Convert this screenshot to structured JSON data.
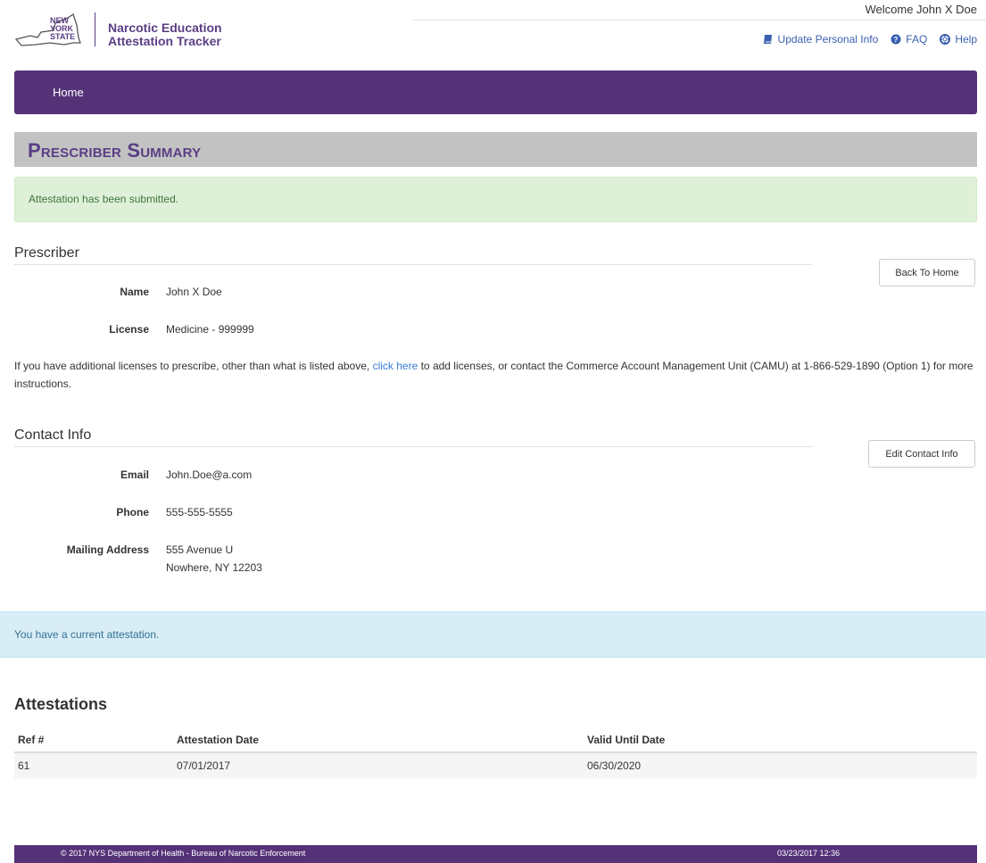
{
  "header": {
    "brand_lines": [
      "NEW",
      "YORK",
      "STATE"
    ],
    "app_title_line1": "Narcotic Education",
    "app_title_line2": "Attestation Tracker",
    "welcome": "Welcome John X Doe",
    "links": {
      "update_info": "Update Personal Info",
      "faq": "FAQ",
      "help": "Help"
    }
  },
  "nav": {
    "home": "Home"
  },
  "page_title": "Prescriber Summary",
  "success_alert": "Attestation has been submitted.",
  "prescriber": {
    "heading": "Prescriber",
    "back_button": "Back To Home",
    "name_label": "Name",
    "name_value": "John X Doe",
    "license_label": "License",
    "license_value": "Medicine - 999999"
  },
  "licenses_note": {
    "before": "If you have additional licenses to prescribe, other than what is listed above, ",
    "link": "click here",
    "after": " to add licenses, or contact the Commerce Account Management Unit (CAMU) at 1-866-529-1890 (Option 1) for more instructions."
  },
  "contact": {
    "heading": "Contact Info",
    "edit_button": "Edit Contact Info",
    "email_label": "Email",
    "email_value": "John.Doe@a.com",
    "phone_label": "Phone",
    "phone_value": "555-555-5555",
    "address_label": "Mailing Address",
    "address_line1": "555 Avenue U",
    "address_line2": "Nowhere, NY 12203"
  },
  "info_alert": "You have a current attestation.",
  "attestations": {
    "title": "Attestations",
    "columns": [
      "Ref #",
      "Attestation Date",
      "Valid Until Date"
    ],
    "rows": [
      {
        "ref": "61",
        "attestation_date": "07/01/2017",
        "valid_until": "06/30/2020"
      }
    ]
  },
  "footer": {
    "copyright": "© 2017 NYS Department of Health - Bureau of Narcotic Enforcement",
    "timestamp": "03/23/2017 12:36"
  },
  "colors": {
    "brand_purple": "#553278",
    "success_bg": "#dff0d8",
    "info_bg": "#d9edf7",
    "link_blue": "#3a7bd5"
  }
}
